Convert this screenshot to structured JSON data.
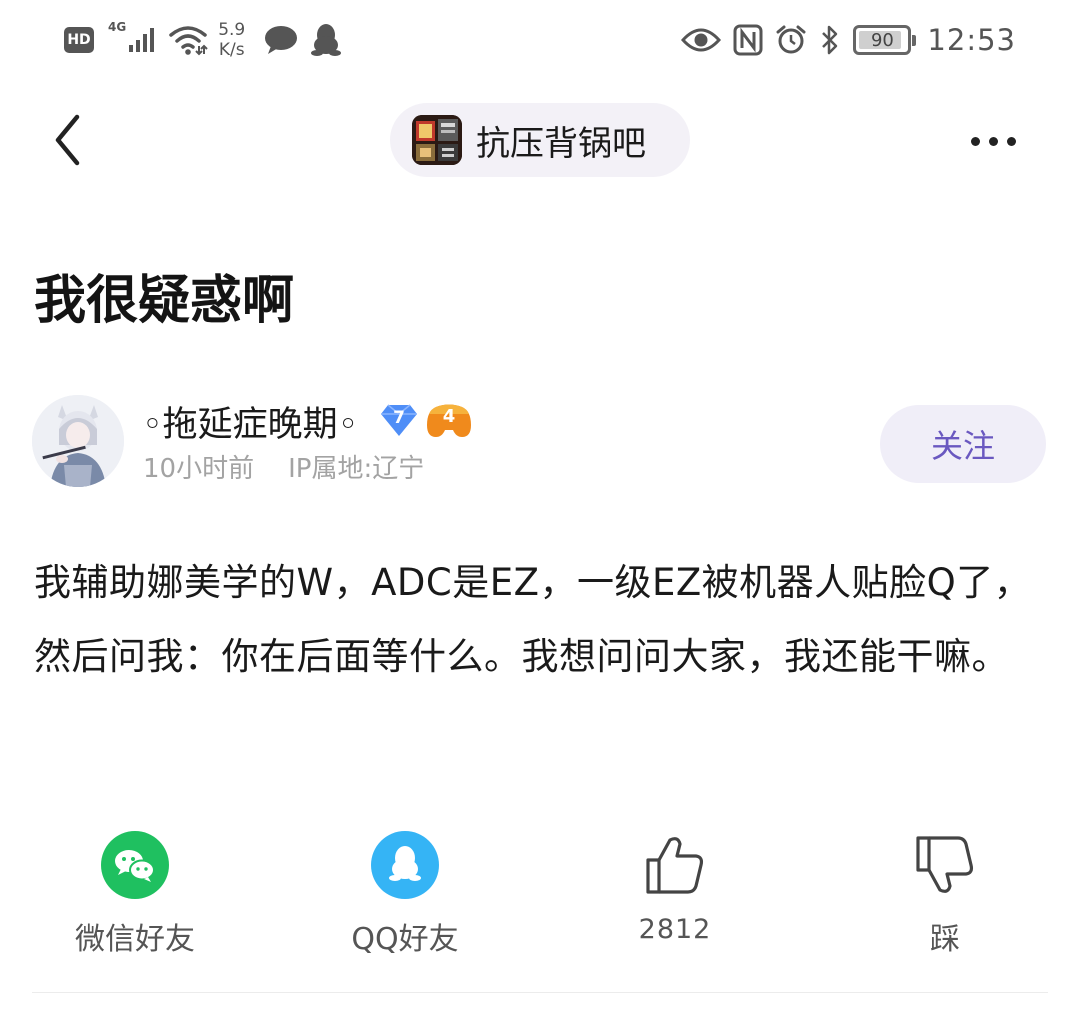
{
  "status_bar": {
    "hd": "HD",
    "network": "4G",
    "speed_value": "5.9",
    "speed_unit": "K/s",
    "battery": "90",
    "battery_level": 0.9,
    "time": "12:53",
    "icons": [
      "signal-icon",
      "wifi-icon",
      "chat-bubble-icon",
      "qq-penguin-icon",
      "eye-icon",
      "nfc-icon",
      "alarm-icon",
      "bluetooth-icon",
      "battery-icon"
    ]
  },
  "header": {
    "back_icon": "back-chevron-icon",
    "forum_name": "抗压背锅吧",
    "more_icon": "more-dots-icon"
  },
  "post": {
    "title": "我很疑惑啊",
    "author": {
      "name": "◦拖延症晚期◦",
      "level": "7",
      "game_badge": "4",
      "time": "10小时前",
      "location": "IP属地:辽宁",
      "follow_label": "关注"
    },
    "body": "我辅助娜美学的W，ADC是EZ，一级EZ被机器人贴脸Q了，然后问我：你在后面等什么。我想问问大家，我还能干嘛。"
  },
  "actions": {
    "wechat_label": "微信好友",
    "qq_label": "QQ好友",
    "like_count": "2812",
    "dislike_label": "踩"
  },
  "colors": {
    "accent": "#6a58c0",
    "follow_bg": "#f0eef8",
    "chip_bg": "#f3f1f7",
    "wechat": "#1fc060",
    "qq": "#35b4f5",
    "meta_text": "#a3a3a3",
    "level_badge": "#4f8ef7",
    "game_badge": "#f08a1c"
  }
}
